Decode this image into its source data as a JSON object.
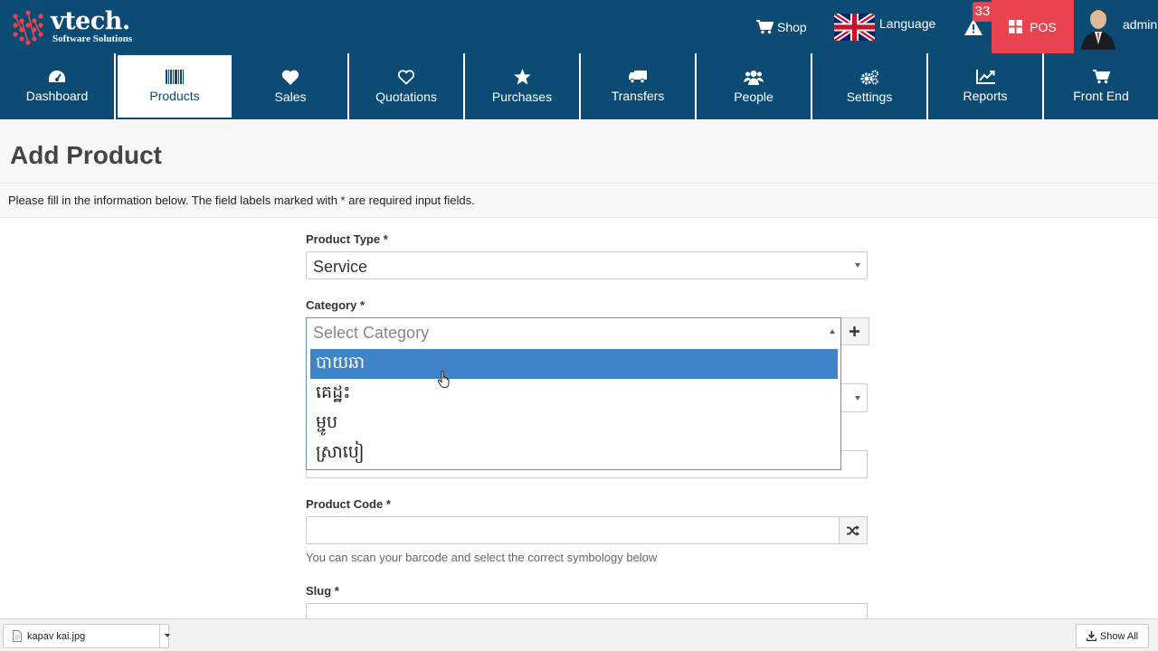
{
  "header": {
    "logo_title": "vtech.",
    "logo_subtitle": "Software Solutions",
    "shop_label": "Shop",
    "language_label": "Language",
    "alert_count": "33",
    "pos_label": "POS",
    "user_label": "admin"
  },
  "nav": {
    "items": [
      {
        "label": "Dashboard",
        "icon": "dashboard-icon"
      },
      {
        "label": "Products",
        "icon": "barcode-icon"
      },
      {
        "label": "Sales",
        "icon": "heart-icon"
      },
      {
        "label": "Quotations",
        "icon": "heart-outline-icon"
      },
      {
        "label": "Purchases",
        "icon": "star-icon"
      },
      {
        "label": "Transfers",
        "icon": "truck-icon"
      },
      {
        "label": "People",
        "icon": "users-icon"
      },
      {
        "label": "Settings",
        "icon": "cogs-icon"
      },
      {
        "label": "Reports",
        "icon": "line-chart-icon"
      },
      {
        "label": "Front End",
        "icon": "cart-icon"
      }
    ],
    "active": "Products"
  },
  "page": {
    "title": "Add Product",
    "intro": "Please fill in the information below. The field labels marked with * are required input fields."
  },
  "form": {
    "product_type_label": "Product Type *",
    "product_type_value": "Service",
    "category_label": "Category *",
    "category_placeholder": "Select Category",
    "category_options": [
      "បាយឆា",
      "គេដ្ឋះ",
      "ម្ជូប",
      "ស្រាបៀ"
    ],
    "category_highlighted": "បាយឆា",
    "product_code_label": "Product Code *",
    "product_code_value": "",
    "product_code_help": "You can scan your barcode and select the correct symbology below",
    "slug_label": "Slug *"
  },
  "downloads": {
    "file_name": "kapav kai.jpg",
    "show_all_label": "Show All"
  },
  "colors": {
    "primary": "#0c4b74",
    "accent": "#e8434f",
    "highlight": "#3f83c9"
  }
}
